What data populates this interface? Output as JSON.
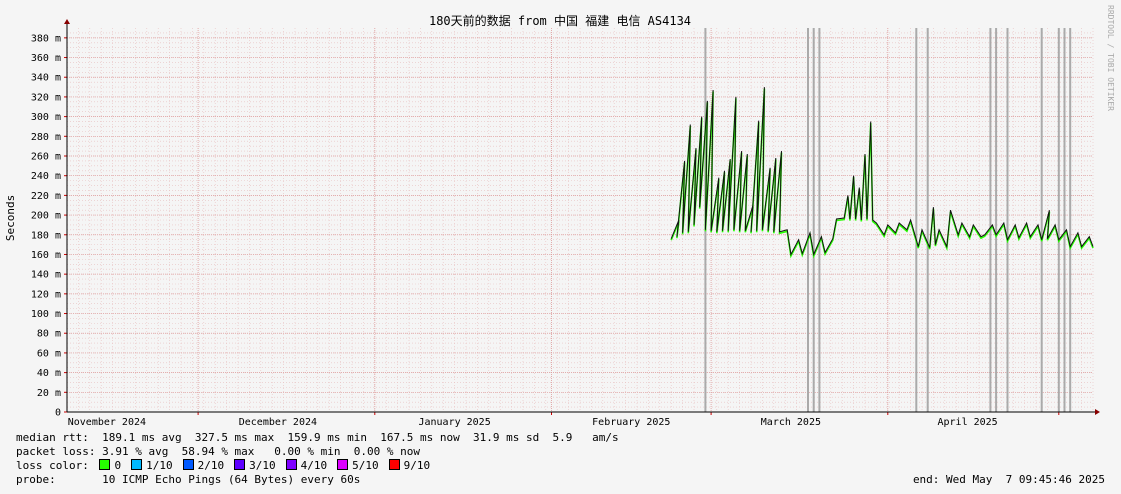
{
  "chart_data": {
    "type": "line",
    "title": "180天前的数据 from 中国 福建 电信 AS4134",
    "ylabel": "Seconds",
    "watermark": "RRDTOOL / TOBI OETIKER",
    "ylim": [
      0,
      0.39
    ],
    "y_ticks": [
      {
        "v": 0,
        "label": "0"
      },
      {
        "v": 0.02,
        "label": "20 m"
      },
      {
        "v": 0.04,
        "label": "40 m"
      },
      {
        "v": 0.06,
        "label": "60 m"
      },
      {
        "v": 0.08,
        "label": "80 m"
      },
      {
        "v": 0.1,
        "label": "100 m"
      },
      {
        "v": 0.12,
        "label": "120 m"
      },
      {
        "v": 0.14,
        "label": "140 m"
      },
      {
        "v": 0.16,
        "label": "160 m"
      },
      {
        "v": 0.18,
        "label": "180 m"
      },
      {
        "v": 0.2,
        "label": "200 m"
      },
      {
        "v": 0.22,
        "label": "220 m"
      },
      {
        "v": 0.24,
        "label": "240 m"
      },
      {
        "v": 0.26,
        "label": "260 m"
      },
      {
        "v": 0.28,
        "label": "280 m"
      },
      {
        "v": 0.3,
        "label": "300 m"
      },
      {
        "v": 0.32,
        "label": "320 m"
      },
      {
        "v": 0.34,
        "label": "340 m"
      },
      {
        "v": 0.36,
        "label": "360 m"
      },
      {
        "v": 0.38,
        "label": "380 m"
      }
    ],
    "xlim": [
      "2024-11-08",
      "2025-05-07"
    ],
    "x_ticks": [
      {
        "x": "2024-11-15",
        "label": "November 2024"
      },
      {
        "x": "2024-12-15",
        "label": "December 2024"
      },
      {
        "x": "2025-01-15",
        "label": "January 2025"
      },
      {
        "x": "2025-02-15",
        "label": "February 2025"
      },
      {
        "x": "2025-03-15",
        "label": "March 2025"
      },
      {
        "x": "2025-04-15",
        "label": "April 2025"
      }
    ],
    "x_major": [
      "2024-11-01",
      "2024-12-01",
      "2025-01-01",
      "2025-02-01",
      "2025-03-01",
      "2025-04-01",
      "2025-05-01"
    ],
    "series": [
      {
        "name": "median rtt",
        "points": [
          [
            "2025-02-22",
            0.176
          ],
          [
            "2025-02-23",
            0.195
          ],
          [
            "2025-02-23",
            0.178
          ],
          [
            "2025-02-24",
            0.255
          ],
          [
            "2025-02-24",
            0.182
          ],
          [
            "2025-02-25",
            0.292
          ],
          [
            "2025-02-25",
            0.183
          ],
          [
            "2025-02-26",
            0.268
          ],
          [
            "2025-02-26",
            0.19
          ],
          [
            "2025-02-27",
            0.3
          ],
          [
            "2025-02-27",
            0.208
          ],
          [
            "2025-02-28",
            0.316
          ],
          [
            "2025-02-28",
            0.185
          ],
          [
            "2025-03-01",
            0.327
          ],
          [
            "2025-03-01",
            0.184
          ],
          [
            "2025-03-02",
            0.238
          ],
          [
            "2025-03-02",
            0.183
          ],
          [
            "2025-03-03",
            0.245
          ],
          [
            "2025-03-03",
            0.184
          ],
          [
            "2025-03-04",
            0.257
          ],
          [
            "2025-03-04",
            0.184
          ],
          [
            "2025-03-05",
            0.32
          ],
          [
            "2025-03-05",
            0.185
          ],
          [
            "2025-03-06",
            0.265
          ],
          [
            "2025-03-06",
            0.184
          ],
          [
            "2025-03-07",
            0.262
          ],
          [
            "2025-03-07",
            0.184
          ],
          [
            "2025-03-08",
            0.21
          ],
          [
            "2025-03-08",
            0.183
          ],
          [
            "2025-03-09",
            0.296
          ],
          [
            "2025-03-09",
            0.184
          ],
          [
            "2025-03-10",
            0.33
          ],
          [
            "2025-03-10",
            0.185
          ],
          [
            "2025-03-11",
            0.248
          ],
          [
            "2025-03-11",
            0.184
          ],
          [
            "2025-03-12",
            0.258
          ],
          [
            "2025-03-12",
            0.183
          ],
          [
            "2025-03-13",
            0.265
          ],
          [
            "2025-03-13",
            0.183
          ],
          [
            "2025-03-14",
            0.185
          ],
          [
            "2025-03-15",
            0.16
          ],
          [
            "2025-03-16",
            0.175
          ],
          [
            "2025-03-17",
            0.161
          ],
          [
            "2025-03-18",
            0.182
          ],
          [
            "2025-03-19",
            0.16
          ],
          [
            "2025-03-20",
            0.178
          ],
          [
            "2025-03-21",
            0.162
          ],
          [
            "2025-03-22",
            0.176
          ],
          [
            "2025-03-23",
            0.196
          ],
          [
            "2025-03-24",
            0.197
          ],
          [
            "2025-03-25",
            0.22
          ],
          [
            "2025-03-25",
            0.196
          ],
          [
            "2025-03-26",
            0.24
          ],
          [
            "2025-03-26",
            0.196
          ],
          [
            "2025-03-27",
            0.228
          ],
          [
            "2025-03-27",
            0.195
          ],
          [
            "2025-03-28",
            0.262
          ],
          [
            "2025-03-28",
            0.196
          ],
          [
            "2025-03-29",
            0.295
          ],
          [
            "2025-03-29",
            0.195
          ],
          [
            "2025-03-30",
            0.192
          ],
          [
            "2025-03-31",
            0.18
          ],
          [
            "2025-04-01",
            0.19
          ],
          [
            "2025-04-02",
            0.182
          ],
          [
            "2025-04-03",
            0.192
          ],
          [
            "2025-04-04",
            0.185
          ],
          [
            "2025-04-05",
            0.195
          ],
          [
            "2025-04-06",
            0.168
          ],
          [
            "2025-04-07",
            0.185
          ],
          [
            "2025-04-08",
            0.167
          ],
          [
            "2025-04-09",
            0.208
          ],
          [
            "2025-04-09",
            0.17
          ],
          [
            "2025-04-10",
            0.185
          ],
          [
            "2025-04-11",
            0.168
          ],
          [
            "2025-04-12",
            0.205
          ],
          [
            "2025-04-13",
            0.18
          ],
          [
            "2025-04-14",
            0.192
          ],
          [
            "2025-04-15",
            0.178
          ],
          [
            "2025-04-16",
            0.19
          ],
          [
            "2025-04-17",
            0.178
          ],
          [
            "2025-04-18",
            0.18
          ],
          [
            "2025-04-19",
            0.19
          ],
          [
            "2025-04-20",
            0.18
          ],
          [
            "2025-04-21",
            0.192
          ],
          [
            "2025-04-22",
            0.175
          ],
          [
            "2025-04-23",
            0.19
          ],
          [
            "2025-04-24",
            0.177
          ],
          [
            "2025-04-25",
            0.192
          ],
          [
            "2025-04-26",
            0.178
          ],
          [
            "2025-04-27",
            0.19
          ],
          [
            "2025-04-28",
            0.175
          ],
          [
            "2025-04-29",
            0.205
          ],
          [
            "2025-04-29",
            0.176
          ],
          [
            "2025-04-30",
            0.19
          ],
          [
            "2025-05-01",
            0.175
          ],
          [
            "2025-05-02",
            0.185
          ],
          [
            "2025-05-03",
            0.168
          ],
          [
            "2025-05-04",
            0.182
          ],
          [
            "2025-05-05",
            0.168
          ],
          [
            "2025-05-06",
            0.178
          ],
          [
            "2025-05-07",
            0.168
          ]
        ]
      }
    ],
    "loss_spikes": [
      "2025-02-28",
      "2025-03-18",
      "2025-03-19",
      "2025-03-20",
      "2025-04-06",
      "2025-04-08",
      "2025-04-19",
      "2025-04-20",
      "2025-04-22",
      "2025-04-28",
      "2025-05-01",
      "2025-05-02",
      "2025-05-03"
    ]
  },
  "legend": {
    "median_label": "median rtt:",
    "median_stats": "189.1 ms avg  327.5 ms max  159.9 ms min  167.5 ms now  31.9 ms sd  5.9   am/s",
    "loss_label": "packet loss:",
    "loss_stats": "3.91 % avg  58.94 % max   0.00 % min  0.00 % now",
    "color_label": "loss color:",
    "colors": [
      {
        "label": "0",
        "color": "#26ff00"
      },
      {
        "label": "1/10",
        "color": "#00b8ff"
      },
      {
        "label": "2/10",
        "color": "#0059ff"
      },
      {
        "label": "3/10",
        "color": "#5e00ff"
      },
      {
        "label": "4/10",
        "color": "#7e00ff"
      },
      {
        "label": "5/10",
        "color": "#dd00ff"
      },
      {
        "label": "9/10",
        "color": "#ff0000"
      }
    ],
    "probe_label": "probe:",
    "probe_text": "10 ICMP Echo Pings (64 Bytes) every 60s",
    "end_text": "end: Wed May  7 09:45:46 2025"
  }
}
